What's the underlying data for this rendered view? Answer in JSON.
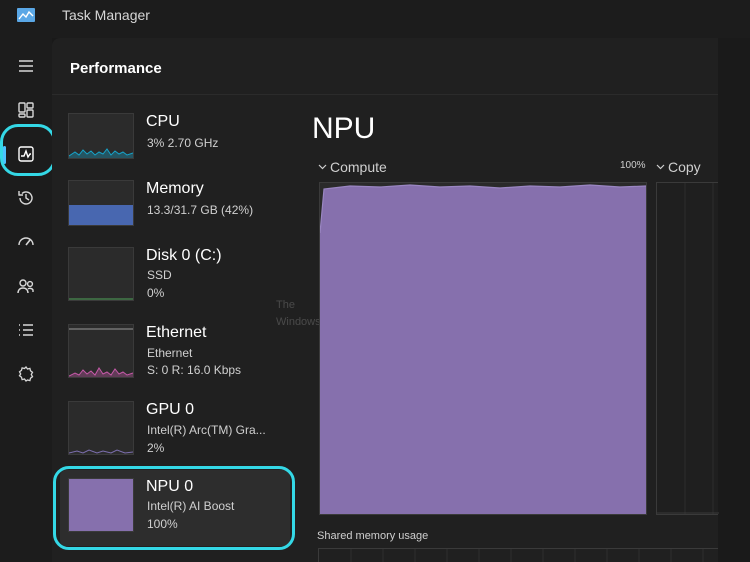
{
  "window": {
    "title": "Task Manager"
  },
  "nav": {
    "items": [
      {
        "id": "menu",
        "icon": "hamburger-icon"
      },
      {
        "id": "processes",
        "icon": "processes-icon"
      },
      {
        "id": "performance",
        "icon": "performance-icon",
        "active": true
      },
      {
        "id": "app-history",
        "icon": "history-icon"
      },
      {
        "id": "startup-apps",
        "icon": "startup-icon"
      },
      {
        "id": "users",
        "icon": "users-icon"
      },
      {
        "id": "details",
        "icon": "details-list-icon"
      },
      {
        "id": "services",
        "icon": "services-gear-icon"
      }
    ]
  },
  "page": {
    "title": "Performance"
  },
  "devices": [
    {
      "name": "CPU",
      "sub1": "3%  2.70 GHz",
      "sub2": "",
      "color": "#17a3c9"
    },
    {
      "name": "Memory",
      "sub1": "13.3/31.7 GB (42%)",
      "sub2": "",
      "color": "#4e72c8"
    },
    {
      "name": "Disk 0 (C:)",
      "sub1": "SSD",
      "sub2": "0%",
      "color": "#4fa35a"
    },
    {
      "name": "Ethernet",
      "sub1": "Ethernet",
      "sub2": "S: 0 R: 16.0 Kbps",
      "color": "#c65aa8"
    },
    {
      "name": "GPU 0",
      "sub1": "Intel(R) Arc(TM) Gra...",
      "sub2": "2%",
      "color": "#7d6fb0"
    },
    {
      "name": "NPU 0",
      "sub1": "Intel(R) AI Boost",
      "sub2": "100%",
      "color": "#8670ad",
      "selected": true
    }
  ],
  "detail": {
    "title": "NPU",
    "graph1_label": "Compute",
    "graph1_max": "100%",
    "graph2_label": "Copy",
    "graph1_utilization": 1.0,
    "shared_memory_label": "Shared memory usage",
    "accent": "#8670ad"
  },
  "watermark": {
    "line1": "The",
    "line2": "Windows"
  }
}
